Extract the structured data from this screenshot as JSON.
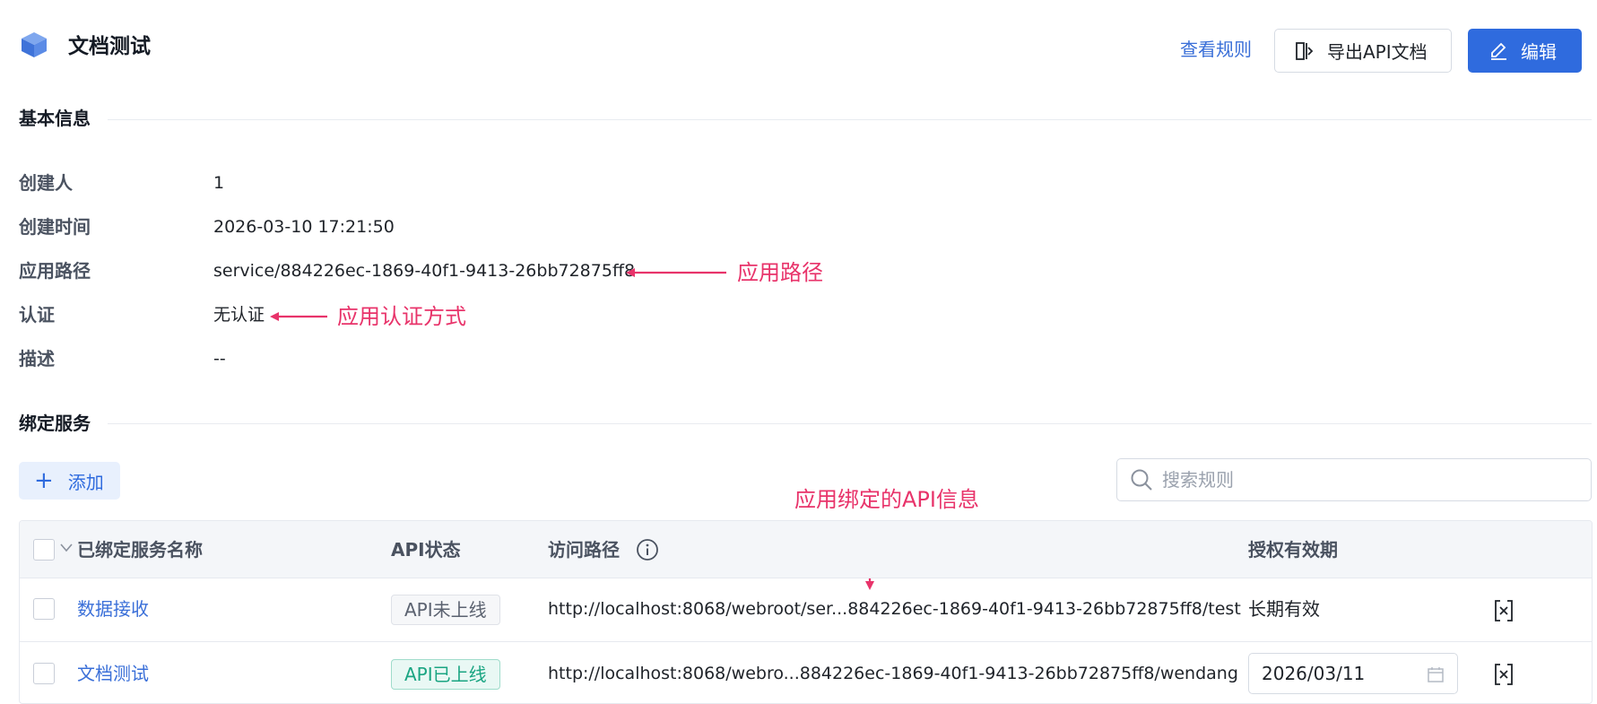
{
  "header": {
    "title": "文档测试",
    "view_rules_label": "查看规则",
    "export_label": "导出API文档",
    "edit_label": "编辑"
  },
  "basic_info": {
    "section_title": "基本信息",
    "rows": [
      {
        "label": "创建人",
        "value": "1"
      },
      {
        "label": "创建时间",
        "value": "2026-03-10 17:21:50"
      },
      {
        "label": "应用路径",
        "value": "service/884226ec-1869-40f1-9413-26bb72875ff8"
      },
      {
        "label": "认证",
        "value": "无认证"
      },
      {
        "label": "描述",
        "value": "--"
      }
    ]
  },
  "annotations": {
    "app_path": "应用路径",
    "auth_method": "应用认证方式",
    "bound_api": "应用绑定的API信息"
  },
  "bound_services": {
    "section_title": "绑定服务",
    "add_label": "添加",
    "search_placeholder": "搜索规则",
    "columns": {
      "name": "已绑定服务名称",
      "status": "API状态",
      "path": "访问路径",
      "validity": "授权有效期"
    },
    "rows": [
      {
        "name": "数据接收",
        "status": "API未上线",
        "path": "http://localhost:8068/webroot/ser...884226ec-1869-40f1-9413-26bb72875ff8/test",
        "validity": "长期有效"
      },
      {
        "name": "文档测试",
        "status": "API已上线",
        "path": "http://localhost:8068/webro...884226ec-1869-40f1-9413-26bb72875ff8/wendang",
        "validity": "2026/03/11"
      }
    ]
  },
  "colors": {
    "primary": "#2f6bde",
    "link": "#3a6fd8",
    "annotation": "#e8336a",
    "status_online": "#1aa582"
  }
}
